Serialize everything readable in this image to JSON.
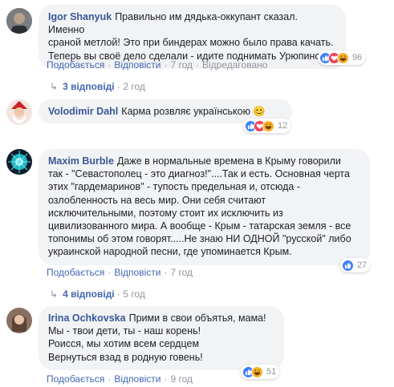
{
  "comments": [
    {
      "author": "Igor Shanyuk",
      "text": "Правильно им дядька-оккупант сказал. Именно\nсраной метлой! Это при биндерах можно было права качать.\nТеперь вы своё дело сделали - идите поднимать Урюпинск.",
      "like_label": "Подобається",
      "reply_label": "Відповісти",
      "time": "7 год",
      "edited": "Відредаговано",
      "reactions_count": "96",
      "reactions": [
        "like-icon",
        "love-icon",
        "haha-icon"
      ],
      "replies_label": "3 відповіді",
      "replies_time": "2 год"
    },
    {
      "author": "Volodimir Dahl",
      "text": "Карма розвляє українською 😊",
      "reactions_count": "12",
      "reactions": [
        "like-icon",
        "love-icon",
        "haha-icon"
      ]
    },
    {
      "author": "Maxim Burble",
      "text": "Даже в нормальные времена в Крыму говорили\nтак - \"Севастополец - это диагноз!\"....Так и есть. Основная черта\nэтих \"гардемаринов\" - тупость предельная и, отсюда -\nозлобленность на весь мир. Они себя считают\nисключительными, поэтому стоит их исключить из\nцивилизованного мира. А вообще - Крым - татарская земля - все\nтопонимы об этом говорят.....Не знаю НИ ОДНОЙ \"русской\" либо\nукраинской народной песни, где упоминается Крым.",
      "like_label": "Подобається",
      "reply_label": "Відповісти",
      "time": "7 год",
      "reactions_count": "27",
      "reactions": [
        "like-icon"
      ],
      "replies_label": "4 відповіді",
      "replies_time": "5 год"
    },
    {
      "author": "Irina Ochkovska",
      "text": "Прими в свои объятья, мама!\nМы - твои дети, ты - наш корень!\nРоисся, мы хотим всем сердцем\nВернуться взад в родную говень!",
      "like_label": "Подобається",
      "reply_label": "Відповісти",
      "time": "9 год",
      "reactions_count": "51",
      "reactions": [
        "like-icon",
        "haha-icon"
      ]
    }
  ],
  "colors": {
    "link": "#4267b2",
    "author": "#385898",
    "meta": "#90949c",
    "bubble": "#f2f3f5",
    "like": "#4080ff",
    "love": "#f33e58",
    "haha": "#f7b125"
  }
}
